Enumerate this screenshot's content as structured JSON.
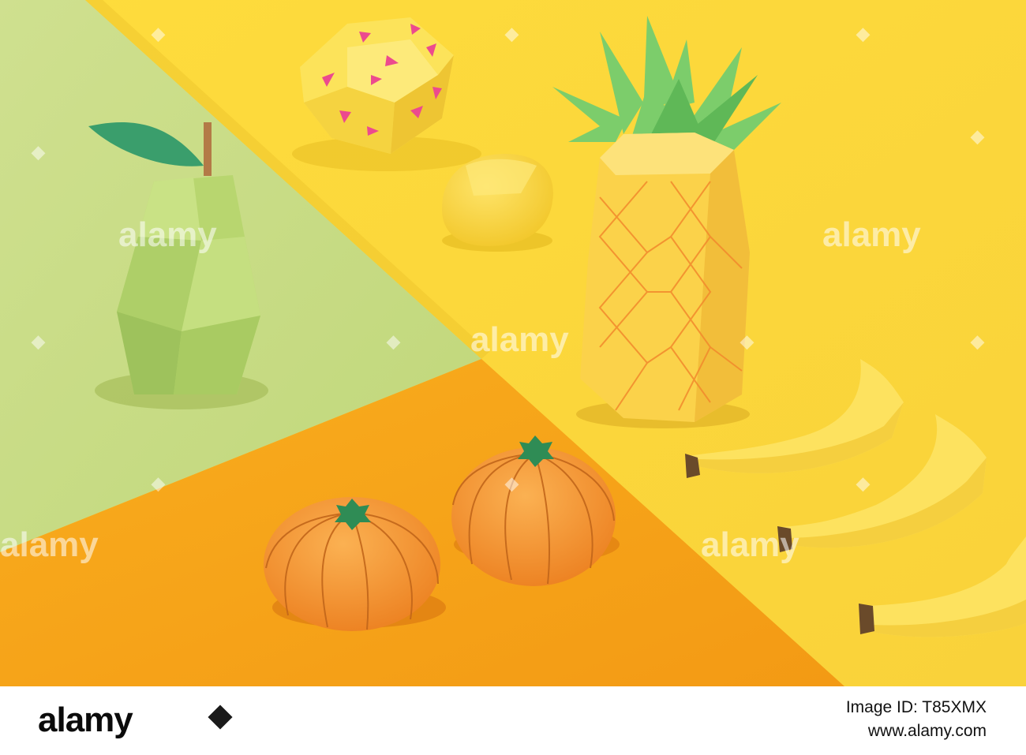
{
  "photo": {
    "subject": "origami paper fruits on colorful paper",
    "palette": {
      "yellow_background": "#fcd93a",
      "green_background": "#c8dc82",
      "orange_background": "#f7a11b",
      "pear": "#b5d46f",
      "pineapple": "#fbd24a",
      "pineapple_leaves": "#7ccd6b",
      "tangerine": "#f49a2d",
      "banana": "#fde25f",
      "lemon": "#fbd737",
      "polyhedron_fruit": "#fce35a",
      "polyhedron_marks": "#ec4a8e"
    },
    "watermark": "alamy"
  },
  "footer": {
    "logo_text": "alamy",
    "image_id_line": "Image ID: T85XMX",
    "url_line": "www.alamy.com"
  }
}
